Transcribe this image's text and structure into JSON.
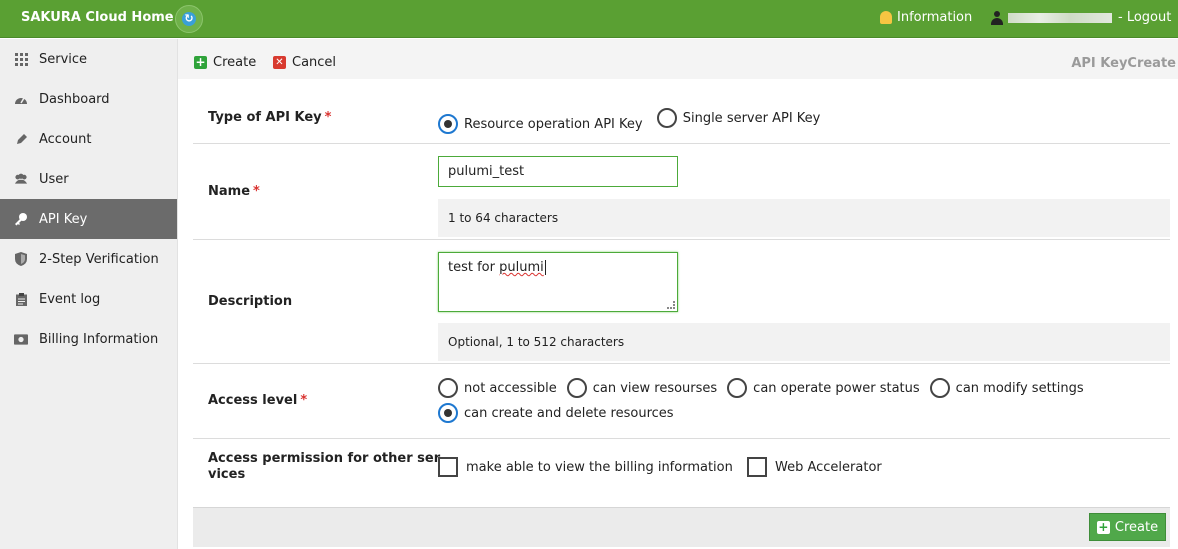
{
  "header": {
    "brand": "SAKURA Cloud Home :",
    "information": "Information",
    "logout": "- Logout"
  },
  "sidebar": {
    "items": [
      {
        "label": "Service",
        "icon": "grid-icon"
      },
      {
        "label": "Dashboard",
        "icon": "gauge-icon"
      },
      {
        "label": "Account",
        "icon": "pen-icon"
      },
      {
        "label": "User",
        "icon": "users-icon"
      },
      {
        "label": "API Key",
        "icon": "key-icon",
        "active": true
      },
      {
        "label": "2-Step Verification",
        "icon": "shield-icon"
      },
      {
        "label": "Event log",
        "icon": "clipboard-icon"
      },
      {
        "label": "Billing Information",
        "icon": "money-icon"
      }
    ]
  },
  "toolbar": {
    "create_label": "Create",
    "cancel_label": "Cancel",
    "page_title": "API KeyCreate"
  },
  "form": {
    "type": {
      "label": "Type of API Key",
      "required": "*",
      "options": [
        "Resource operation API Key",
        "Single server API Key"
      ],
      "selected": "Resource operation API Key"
    },
    "name": {
      "label": "Name",
      "required": "*",
      "value": "pulumi_test",
      "hint": "1 to 64 characters"
    },
    "description": {
      "label": "Description",
      "value_prefix": "test for ",
      "value_misspelled": "pulumi",
      "hint": "Optional, 1 to 512 characters"
    },
    "access_level": {
      "label": "Access level",
      "required": "*",
      "options": [
        "not accessible",
        "can view resourses",
        "can operate power status",
        "can modify settings",
        "can create and delete resources"
      ],
      "selected": "can create and delete resources"
    },
    "permissions": {
      "label_line1": "Access permission for other ser",
      "label_line2": "vices",
      "options": [
        "make able to view the billing information",
        "Web Accelerator"
      ]
    }
  },
  "footer": {
    "create_label": "Create"
  },
  "colors": {
    "header_green": "#5aa033",
    "sidebar_active": "#6b6b6b",
    "required_red": "#d9322f",
    "input_border": "#4caa3a",
    "radio_checked_ring": "#1e78d0"
  }
}
